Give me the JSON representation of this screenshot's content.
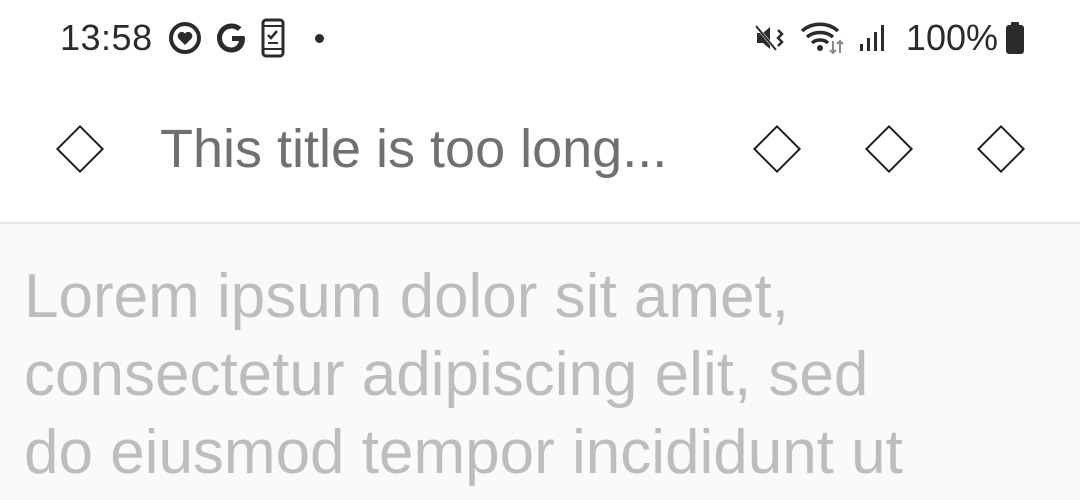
{
  "status_bar": {
    "time": "13:58",
    "battery_percent": "100%",
    "left_icons": [
      "heart-circle-icon",
      "google-g-icon",
      "phone-checklist-icon",
      "notification-dot-icon"
    ],
    "right_icons": [
      "mute-vibrate-icon",
      "wifi-icon",
      "signal-icon",
      "battery-icon"
    ]
  },
  "app_bar": {
    "nav_icon": "diamond-icon",
    "title": "This title is too long...",
    "actions": [
      "diamond-icon",
      "diamond-icon",
      "diamond-icon"
    ]
  },
  "content": {
    "lines": [
      "Lorem ipsum dolor sit amet,",
      "consectetur adipiscing elit, sed",
      "do eiusmod tempor incididunt ut"
    ]
  },
  "colors": {
    "status_text": "#2b2b2b",
    "title_text": "#707070",
    "body_text": "#bdbdbd",
    "background": "#fafafa"
  }
}
